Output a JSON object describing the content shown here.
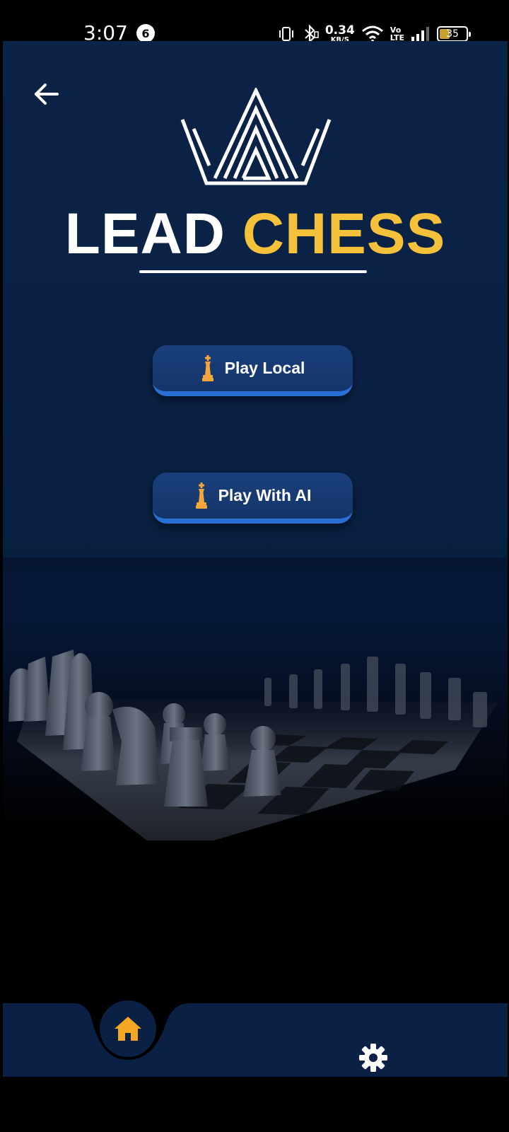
{
  "status_bar": {
    "time": "3:07",
    "notification_count": "6",
    "net_speed_value": "0.34",
    "net_speed_unit": "KB/S",
    "volte_top": "Vo",
    "volte_bottom": "LTE",
    "battery_level": "35"
  },
  "header": {
    "back_icon": "arrow-left-icon"
  },
  "logo": {
    "word1": "LEAD",
    "word2": "CHESS",
    "colors": {
      "primary": "#ffffff",
      "accent": "#f5c13a"
    }
  },
  "menu": {
    "buttons": [
      {
        "label": "Play Local",
        "icon": "chess-king-icon"
      },
      {
        "label": "Play With AI",
        "icon": "chess-king-icon"
      }
    ]
  },
  "bottom_nav": {
    "items": [
      {
        "icon": "home-icon",
        "active": true,
        "color": "#f5a623"
      },
      {
        "icon": "gear-icon",
        "active": false,
        "color": "#ffffff"
      }
    ]
  },
  "theme": {
    "background": "#0a2145",
    "button_fill": "#14356a",
    "button_edge": "#2a6fd6",
    "king_icon_color": "#f5a53a"
  }
}
